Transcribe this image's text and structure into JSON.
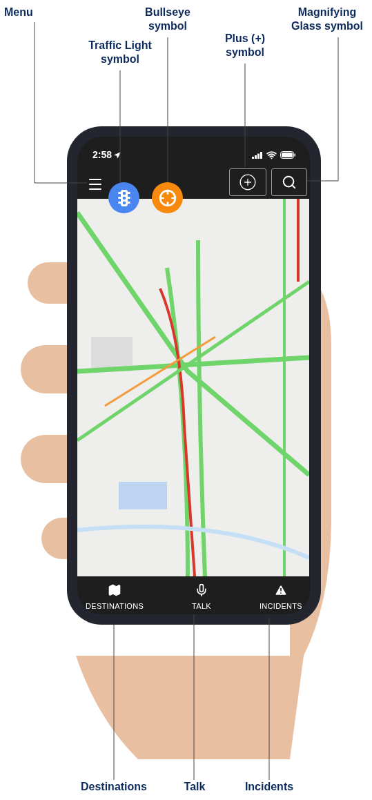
{
  "callouts": [
    {
      "label": "Menu"
    },
    {
      "label": "Traffic Light symbol"
    },
    {
      "label": "Bullseye symbol"
    },
    {
      "label": "Plus (+) symbol"
    },
    {
      "label": "Magnifying Glass symbol"
    },
    {
      "label": "Destinations"
    },
    {
      "label": "Talk"
    },
    {
      "label": "Incidents"
    }
  ],
  "status_bar": {
    "time": "2:58"
  },
  "bottom_nav": [
    {
      "label": "DESTINATIONS"
    },
    {
      "label": "TALK"
    },
    {
      "label": "INCIDENTS"
    }
  ]
}
